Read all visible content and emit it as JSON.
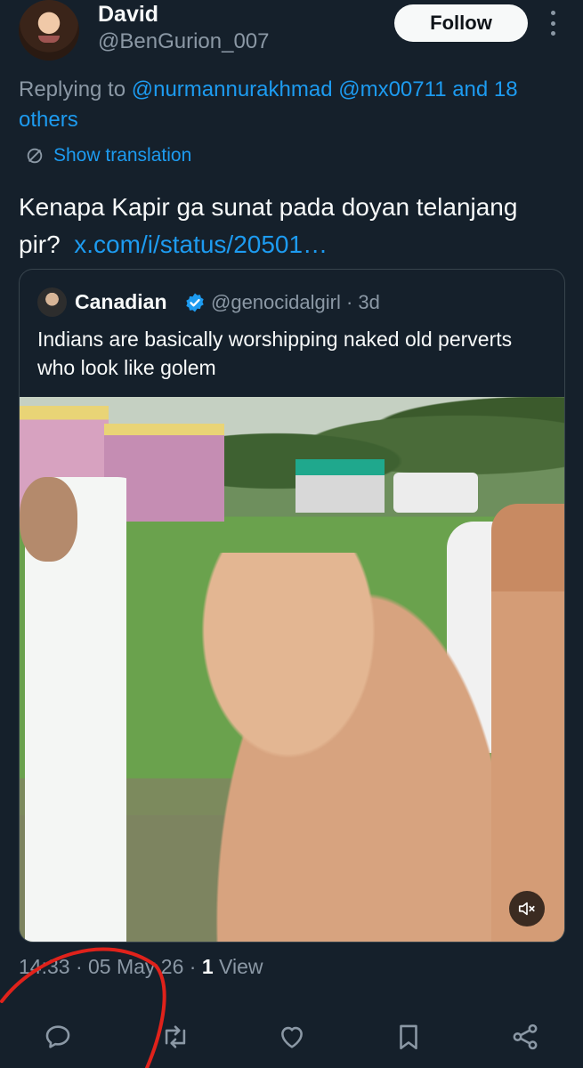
{
  "author": {
    "display_name": "David",
    "handle": "@BenGurion_007",
    "follow_label": "Follow"
  },
  "reply": {
    "prefix": "Replying to ",
    "mentions": "@nurmannurakhmad @mx00711 and 18 others"
  },
  "translation_label": "Show translation",
  "tweet": {
    "text": "Kenapa Kapir ga sunat pada doyan telanjang pir?",
    "link": "x.com/i/status/20501…"
  },
  "quote": {
    "display_name": "Canadian",
    "handle_time": "@genocidalgirl · 3d",
    "text": "Indians are basically worshipping naked old perverts who look like golem",
    "verified": true
  },
  "meta": {
    "timestamp": "14:33 · 05 May 26 · ",
    "view_count": "1",
    "view_label": " View"
  },
  "actions": {
    "icons": [
      "reply-icon",
      "retweet-icon",
      "like-icon",
      "bookmark-icon",
      "share-icon"
    ]
  },
  "colors": {
    "background": "#15202b",
    "accent": "#1d9bf0",
    "muted_text": "#8b98a5",
    "annotation": "#e0221b"
  }
}
